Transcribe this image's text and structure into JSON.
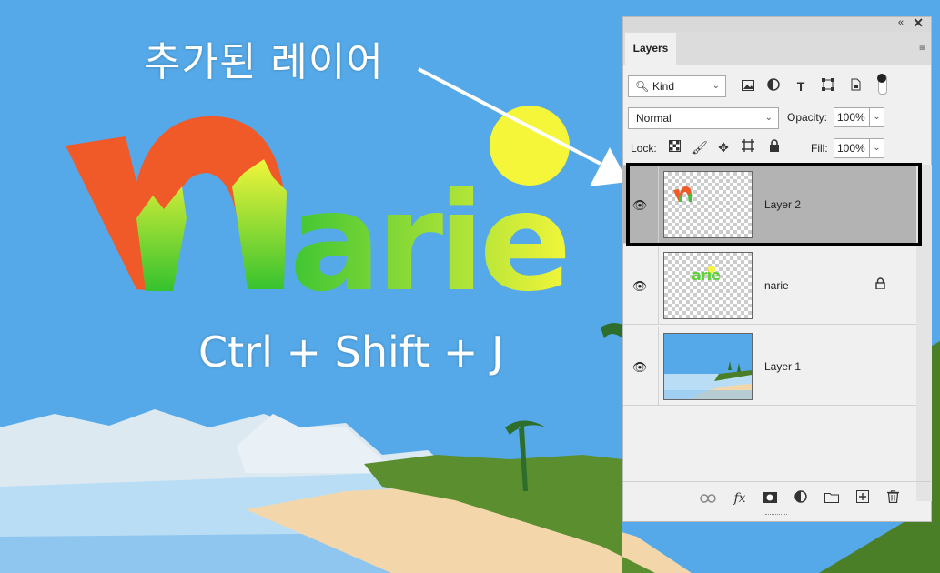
{
  "canvas": {
    "caption_added_layer": "추가된 레이어",
    "shortcut": "Ctrl + Shift + J",
    "colors": {
      "sky": "#55a9e8",
      "sun": "#f5f53a",
      "logo_red": "#f05a28",
      "logo_green": "#3ec533",
      "sand": "#f3d7aa",
      "sea": "#b9ddf4"
    }
  },
  "panel": {
    "tab_label": "Layers",
    "collapse_icon": "double-chevron-icon",
    "close_icon": "close-icon",
    "menu_icon": "hamburger-icon",
    "kind_filter": {
      "icon": "search-icon",
      "label": "Kind"
    },
    "filter_icons": [
      "image-filter-icon",
      "adjustment-filter-icon",
      "type-filter-icon",
      "shape-filter-icon",
      "smart-object-filter-icon",
      "filter-toggle"
    ],
    "blend_mode": "Normal",
    "opacity_label": "Opacity:",
    "opacity_value": "100%",
    "lock_label": "Lock:",
    "lock_icons": [
      "lock-transparent-icon",
      "lock-image-icon",
      "lock-position-icon",
      "lock-artboard-icon",
      "lock-all-icon"
    ],
    "fill_label": "Fill:",
    "fill_value": "100%",
    "layers": [
      {
        "name": "Layer 2",
        "selected": true,
        "visible": true,
        "locked": false
      },
      {
        "name": "narie",
        "selected": false,
        "visible": true,
        "locked": true
      },
      {
        "name": "Layer 1",
        "selected": false,
        "visible": true,
        "locked": false
      }
    ],
    "bottom_icons": [
      "link-icon",
      "fx-icon",
      "mask-icon",
      "adjustment-layer-icon",
      "folder-icon",
      "new-layer-icon",
      "trash-icon"
    ],
    "fx_label": "fx"
  }
}
